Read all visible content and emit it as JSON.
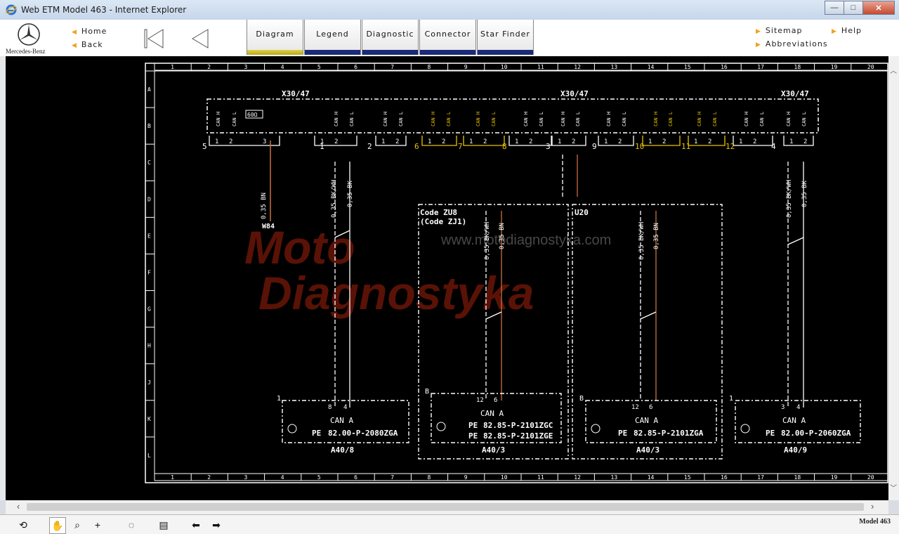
{
  "window": {
    "title": "Web ETM Model 463 - Internet Explorer",
    "min": "—",
    "max": "□",
    "close": "✕"
  },
  "brand": {
    "name": "Mercedes-Benz"
  },
  "nav": {
    "home": "Home",
    "back": "Back",
    "sitemap": "Sitemap",
    "help": "Help",
    "abbreviations": "Abbreviations"
  },
  "tabs": [
    {
      "label": "Diagram",
      "active": true
    },
    {
      "label": "Legend",
      "active": false
    },
    {
      "label": "Diagnostic",
      "active": false
    },
    {
      "label": "Connector",
      "active": false
    },
    {
      "label": "Star Finder",
      "active": false
    }
  ],
  "grid": {
    "columns": [
      "1",
      "2",
      "3",
      "4",
      "5",
      "6",
      "7",
      "8",
      "9",
      "10",
      "11",
      "12",
      "13",
      "14",
      "15",
      "16",
      "17",
      "18",
      "19",
      "20"
    ],
    "rows": [
      "A",
      "B",
      "C",
      "D",
      "E",
      "F",
      "G",
      "H",
      "J",
      "K",
      "L"
    ]
  },
  "colors": {
    "wire_bn": "#c87040",
    "wire_white": "#ffffff",
    "wire_yellow": "#e8c400",
    "watermark": "#7a1a0a",
    "accent_tab": "#1c2a78"
  },
  "connector": {
    "x30_label": "X30/47",
    "resistor": "60Ω",
    "can_h": "CAN H",
    "can_l": "CAN L",
    "pin1": "1",
    "pin2": "2",
    "pin3": "3",
    "group_numbers": [
      "5",
      "1",
      "2",
      "6",
      "7",
      "8",
      "3",
      "9",
      "10",
      "11",
      "12",
      "4"
    ]
  },
  "wires": {
    "bn": "0,35 BN",
    "bkwh": "0,35 BK/WH",
    "bk": "0,35 BK",
    "ground": "W84"
  },
  "codes": {
    "code1": "Code ZU8",
    "code2": "(Code ZJ1)",
    "u20": "U20"
  },
  "watermark": {
    "text1": "Moto",
    "text2": "Diagnostyka",
    "url": "www.motodiagnostyka.com"
  },
  "modules": {
    "can_a": "CAN A",
    "pe_symbol": "PE",
    "m1": {
      "lead": "1",
      "pin_a": "8",
      "pin_b": "4",
      "ref": "82.00-P-2080ZGA",
      "name": "A40/8"
    },
    "m2": {
      "lead": "B",
      "pin_a": "12",
      "pin_b": "6",
      "ref1": "82.85-P-2101ZGC",
      "ref2": "82.85-P-2101ZGE",
      "name": "A40/3"
    },
    "m3": {
      "lead": "B",
      "pin_a": "12",
      "pin_b": "6",
      "ref": "82.85-P-2101ZGA",
      "name": "A40/3"
    },
    "m4": {
      "lead": "1",
      "pin_a": "3",
      "pin_b": "4",
      "ref": "82.00-P-2060ZGA",
      "name": "A40/9"
    }
  },
  "footer": {
    "model": "Model 463"
  }
}
